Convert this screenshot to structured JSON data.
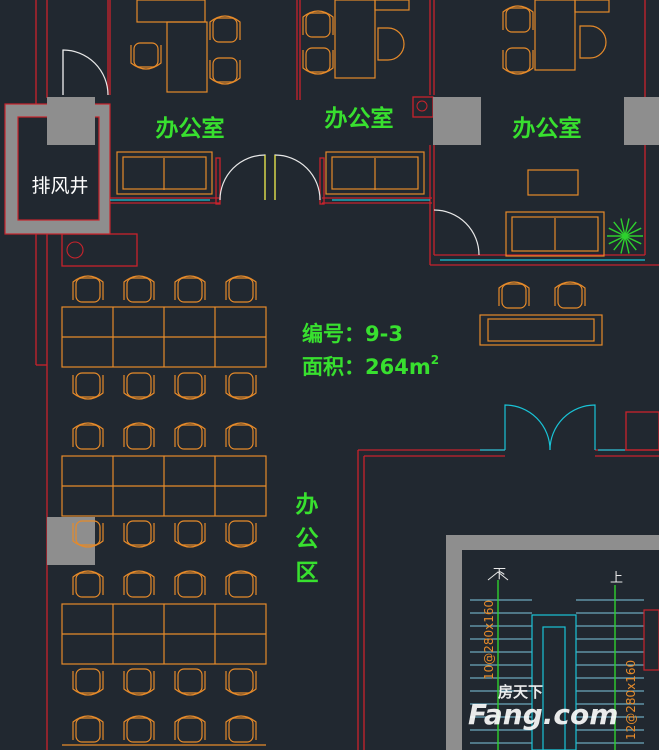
{
  "rooms": {
    "office_1": "办公室",
    "office_2": "办公室",
    "office_3": "办公室",
    "shaft": "排风井",
    "open_area": [
      "办",
      "公",
      "区"
    ]
  },
  "unit_info": {
    "number_line": "编号：9-3",
    "area_line_prefix": "面积：264m",
    "area_superscript": "2"
  },
  "stair": {
    "down_label": "下",
    "up_label": "上",
    "dimension_left": "10@280x160",
    "dimension_right": "12@280x160"
  },
  "watermark": {
    "brand_cn": "房天下",
    "brand_en": "Fang.com"
  },
  "colors": {
    "background": "#212830",
    "wall_red": "#c8232c",
    "furniture_orange": "#e58a2a",
    "label_green": "#38e02f",
    "door_white": "#e8e8e8",
    "window_cyan": "#19c3d6",
    "column_gray": "#8e8e8e",
    "plant_green": "#2ed12e",
    "stair_cyan": "#7ec8e0"
  }
}
